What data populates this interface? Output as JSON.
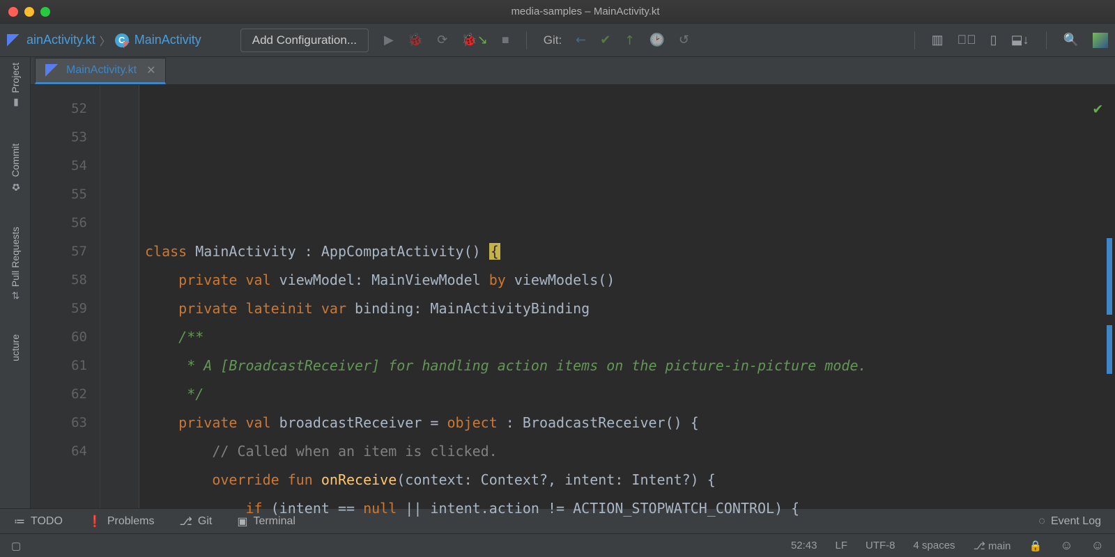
{
  "window": {
    "title": "media-samples – MainActivity.kt"
  },
  "breadcrumbs": {
    "file": "ainActivity.kt",
    "class": "MainActivity"
  },
  "toolbar": {
    "add_config": "Add Configuration...",
    "git_label": "Git:"
  },
  "left_panels": {
    "project": "Project",
    "commit": "Commit",
    "pull_requests": "Pull Requests",
    "structure": "ucture"
  },
  "editor": {
    "tab": {
      "name": "MainActivity.kt"
    },
    "first_line": 52,
    "lines": [
      {
        "n": 52,
        "tokens": [
          {
            "t": "class ",
            "c": "kw"
          },
          {
            "t": "MainActivity : AppCompatActivity() ",
            "c": "ident"
          },
          {
            "t": "{",
            "c": "brace-hl"
          }
        ]
      },
      {
        "n": 53,
        "tokens": [
          {
            "t": ""
          }
        ]
      },
      {
        "n": 54,
        "tokens": [
          {
            "t": "    "
          },
          {
            "t": "private val ",
            "c": "kw"
          },
          {
            "t": "viewModel: MainViewModel ",
            "c": "ident"
          },
          {
            "t": "by ",
            "c": "kw"
          },
          {
            "t": "viewModels()",
            "c": "ident"
          }
        ]
      },
      {
        "n": 55,
        "tokens": [
          {
            "t": "    "
          },
          {
            "t": "private lateinit var ",
            "c": "kw"
          },
          {
            "t": "binding: MainActivityBinding",
            "c": "ident"
          }
        ]
      },
      {
        "n": 56,
        "tokens": [
          {
            "t": ""
          }
        ]
      },
      {
        "n": 57,
        "tokens": [
          {
            "t": "    "
          },
          {
            "t": "/**",
            "c": "doccomment"
          }
        ]
      },
      {
        "n": 58,
        "tokens": [
          {
            "t": "     "
          },
          {
            "t": "* A [BroadcastReceiver] for handling action items on the picture-in-picture mode.",
            "c": "doccomment"
          }
        ]
      },
      {
        "n": 59,
        "tokens": [
          {
            "t": "     "
          },
          {
            "t": "*/",
            "c": "doccomment"
          }
        ]
      },
      {
        "n": 60,
        "tokens": [
          {
            "t": "    "
          },
          {
            "t": "private val ",
            "c": "kw"
          },
          {
            "t": "broadcastReceiver = ",
            "c": "ident"
          },
          {
            "t": "object ",
            "c": "kw"
          },
          {
            "t": ": BroadcastReceiver() {",
            "c": "ident"
          }
        ]
      },
      {
        "n": 61,
        "tokens": [
          {
            "t": ""
          }
        ]
      },
      {
        "n": 62,
        "tokens": [
          {
            "t": "        "
          },
          {
            "t": "// Called when an item is clicked.",
            "c": "comment"
          }
        ]
      },
      {
        "n": 63,
        "tokens": [
          {
            "t": "        "
          },
          {
            "t": "override fun ",
            "c": "kw"
          },
          {
            "t": "onReceive",
            "c": "func"
          },
          {
            "t": "(context: Context?, intent: Intent?) {",
            "c": "ident"
          }
        ]
      },
      {
        "n": 64,
        "tokens": [
          {
            "t": "            "
          },
          {
            "t": "if ",
            "c": "kw"
          },
          {
            "t": "(intent == ",
            "c": "ident"
          },
          {
            "t": "null ",
            "c": "kw"
          },
          {
            "t": "|| intent.action != ACTION_STOPWATCH_CONTROL) {",
            "c": "ident"
          }
        ]
      }
    ]
  },
  "bottom_tools": {
    "todo": "TODO",
    "problems": "Problems",
    "git": "Git",
    "terminal": "Terminal",
    "event_log": "Event Log"
  },
  "status": {
    "line_col": "52:43",
    "line_sep": "LF",
    "encoding": "UTF-8",
    "indent": "4 spaces",
    "branch": "main"
  }
}
